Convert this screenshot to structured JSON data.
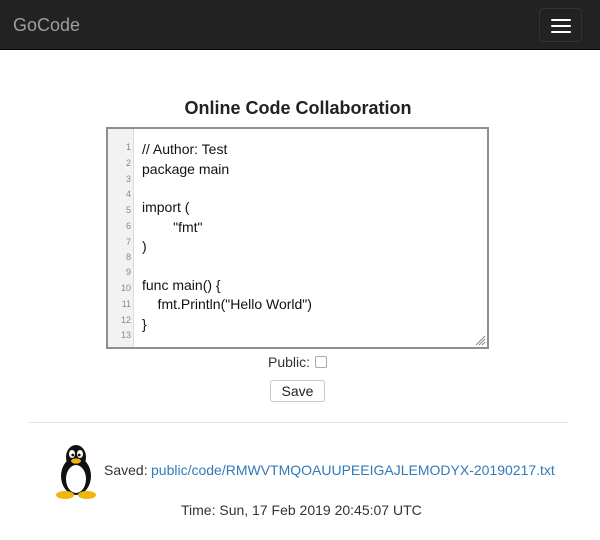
{
  "navbar": {
    "brand": "GoCode",
    "toggle_icon": "hamburger-icon"
  },
  "main": {
    "title": "Online Code Collaboration",
    "editor": {
      "lines": [
        {
          "n": "1",
          "text": "// Author: Test"
        },
        {
          "n": "2",
          "text": "package main"
        },
        {
          "n": "3",
          "text": ""
        },
        {
          "n": "4",
          "text": ""
        },
        {
          "n": "5",
          "text": "import ("
        },
        {
          "n": "6",
          "text": "        \"fmt\""
        },
        {
          "n": "7",
          "text": ")"
        },
        {
          "n": "8",
          "text": ""
        },
        {
          "n": "9",
          "text": ""
        },
        {
          "n": "10",
          "text": "func main() {"
        },
        {
          "n": "11",
          "text": "    fmt.Println(\"Hello World\")"
        },
        {
          "n": "12",
          "text": "}"
        },
        {
          "n": "13",
          "text": ""
        }
      ]
    },
    "public_label": "Public:",
    "public_checked": false,
    "save_label": "Save"
  },
  "result": {
    "saved_label": "Saved:",
    "saved_path": "public/code/RMWVTMQOAUUPEEIGAJLEMODYX-20190217.txt",
    "time_text": "Time: Sun, 17 Feb 2019 20:45:07 UTC",
    "icon": "tux-penguin-icon"
  }
}
